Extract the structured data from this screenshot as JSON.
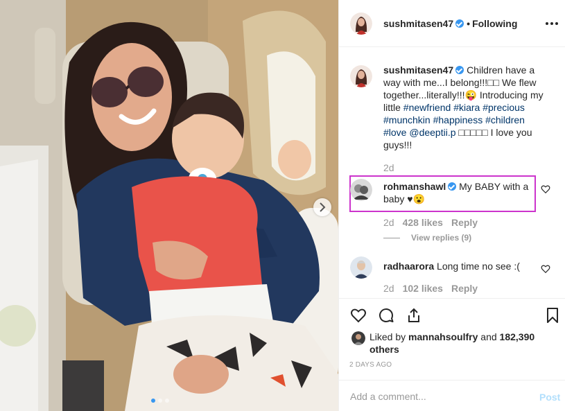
{
  "post": {
    "username": "sushmitasen47",
    "following_label": "Following",
    "separator": "•"
  },
  "caption": {
    "username": "sushmitasen47",
    "text_1": "Children have a way with me...I belong!!!□□ We flew together...literally!!!😜 Introducing my little",
    "hashtags_1": [
      "#newfriend",
      "#kiara",
      "#precious",
      "#munchkin",
      "#happiness",
      "#children",
      "#love"
    ],
    "mention": "@deeptii.p",
    "text_2": "□□□□□ I love you guys!!!",
    "time": "2d"
  },
  "comments": [
    {
      "username": "rohmanshawl",
      "verified": true,
      "text": "My BABY with a baby ♥😮",
      "time": "2d",
      "likes": "428 likes",
      "reply_label": "Reply",
      "view_replies": "View replies (9)"
    },
    {
      "username": "radhaarora",
      "verified": false,
      "text": "Long time no see :(",
      "time": "2d",
      "likes": "102 likes",
      "reply_label": "Reply"
    }
  ],
  "likes": {
    "prefix": "Liked by",
    "user": "mannahsoulfry",
    "joiner": "and",
    "others": "182,390 others"
  },
  "timestamp": "2 DAYS AGO",
  "composer": {
    "placeholder": "Add a comment...",
    "post_label": "Post"
  },
  "carousel": {
    "slides": 3,
    "active_index": 0
  },
  "colors": {
    "link": "#003569",
    "verified": "#3897f0",
    "highlight_border": "#cc33cc",
    "post_disabled": "#b2dffc"
  }
}
